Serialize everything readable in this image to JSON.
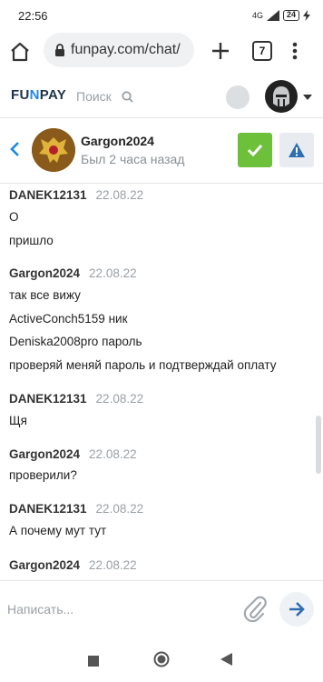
{
  "status_bar": {
    "time": "22:56",
    "network": "4G",
    "battery": "24"
  },
  "browser": {
    "url": "funpay.com/chat/",
    "tab_count": "7"
  },
  "site": {
    "logo_prefix": "FU",
    "logo_middle": "N",
    "logo_suffix": "PAY",
    "search_label": "Поиск"
  },
  "chat": {
    "name": "Gargon2024",
    "status": "Был 2 часа назад"
  },
  "messages": [
    {
      "author": "DANEK12131",
      "date": "22.08.22",
      "lines": [
        "О",
        "пришло"
      ]
    },
    {
      "author": "Gargon2024",
      "date": "22.08.22",
      "lines": [
        "так все вижу",
        "ActiveConch5159 ник",
        "Deniska2008pro пароль",
        "проверяй меняй пароль и подтверждай оплату"
      ]
    },
    {
      "author": "DANEK12131",
      "date": "22.08.22",
      "lines": [
        "Щя"
      ]
    },
    {
      "author": "Gargon2024",
      "date": "22.08.22",
      "lines": [
        "проверили?"
      ]
    },
    {
      "author": "DANEK12131",
      "date": "22.08.22",
      "lines": [
        "А почему мут тут"
      ]
    },
    {
      "author": "Gargon2024",
      "date": "22.08.22",
      "lines": []
    }
  ],
  "composer": {
    "placeholder": "Написать..."
  },
  "colors": {
    "accent": "#1e88e5",
    "confirm": "#6cc03a",
    "warn": "#2f6db3"
  }
}
